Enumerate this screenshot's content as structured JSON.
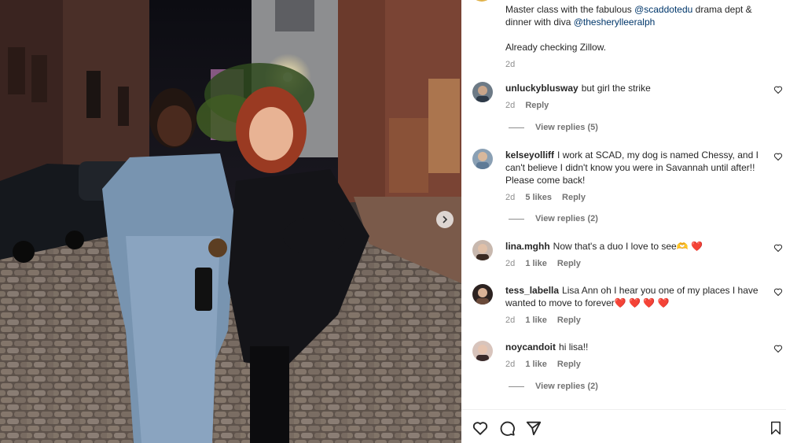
{
  "caption": {
    "line1_pre": "Master class with the fabulous ",
    "mention1": "@scaddotedu",
    "line1_post": " drama dept & dinner with diva ",
    "mention2": "@thesherylleeralph",
    "line2": "Already checking Zillow.",
    "time": "2d"
  },
  "comments": [
    {
      "user": "unluckyblusway",
      "text": "but girl the strike",
      "time": "2d",
      "likes": "",
      "reply": "Reply",
      "view_replies": "View replies (5)"
    },
    {
      "user": "kelseyolliff",
      "text": "I work at SCAD, my dog is named Chessy, and I can't believe I didn't know you were in Savannah until after!! Please come back!",
      "time": "2d",
      "likes": "5 likes",
      "reply": "Reply",
      "view_replies": "View replies (2)"
    },
    {
      "user": "lina.mghh",
      "text": "Now that's a duo I love to see🫶 ❤️",
      "time": "2d",
      "likes": "1 like",
      "reply": "Reply",
      "view_replies": ""
    },
    {
      "user": "tess_labella",
      "text": "Lisa Ann oh I hear you one of my places I have wanted to move to forever❤️ ❤️ ❤️ ❤️",
      "time": "2d",
      "likes": "1 like",
      "reply": "Reply",
      "view_replies": ""
    },
    {
      "user": "noycandoit",
      "text": "hi lisa!!",
      "time": "2d",
      "likes": "1 like",
      "reply": "Reply",
      "view_replies": "View replies (2)"
    }
  ],
  "icons": {
    "like": "heart-icon",
    "comment": "comment-icon",
    "share": "share-icon",
    "save": "bookmark-icon",
    "next": "chevron-right-icon"
  },
  "colors": {
    "mention": "#00376b",
    "meta": "#8e8e8e",
    "heart_red": "#ed1c3a"
  }
}
